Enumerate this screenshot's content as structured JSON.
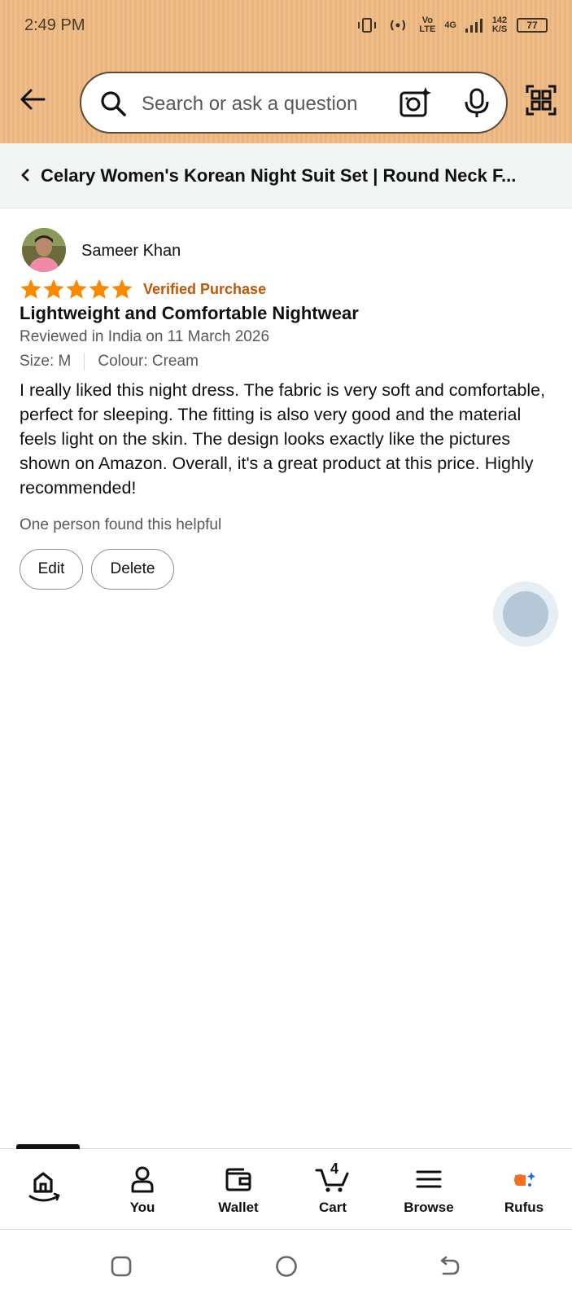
{
  "status_bar": {
    "time": "2:49 PM",
    "vo_lte": "Vo LTE",
    "network": "4G",
    "speed": "142 K/S",
    "battery": "77"
  },
  "header": {
    "search_placeholder": "Search or ask a question"
  },
  "breadcrumb": {
    "title": "Celary Women's Korean Night Suit Set | Round Neck F..."
  },
  "review": {
    "reviewer": "Sameer Khan",
    "rating": 5,
    "rating_max": 5,
    "verified": "Verified Purchase",
    "title": "Lightweight and Comfortable Nightwear",
    "date": "Reviewed in India on 11 March 2026",
    "size": "Size: M",
    "colour": "Colour: Cream",
    "body": "I really liked this night dress. The fabric is very soft and comfortable, perfect for sleeping. The fitting is also very good and the material feels light on the skin. The design looks exactly like the pictures shown on Amazon. Overall, it's a great product at this price. Highly recommended!",
    "helpful": "One person found this helpful",
    "edit_label": "Edit",
    "delete_label": "Delete"
  },
  "bottom_nav": {
    "you": "You",
    "wallet": "Wallet",
    "cart": "Cart",
    "cart_count": "4",
    "browse": "Browse",
    "rufus": "Rufus"
  },
  "colors": {
    "header_bg": "#efbd89",
    "star": "#fa8900",
    "verified": "#c45500",
    "rufus": "#fa6d1b",
    "rufus_spark": "#1b6ee8"
  }
}
